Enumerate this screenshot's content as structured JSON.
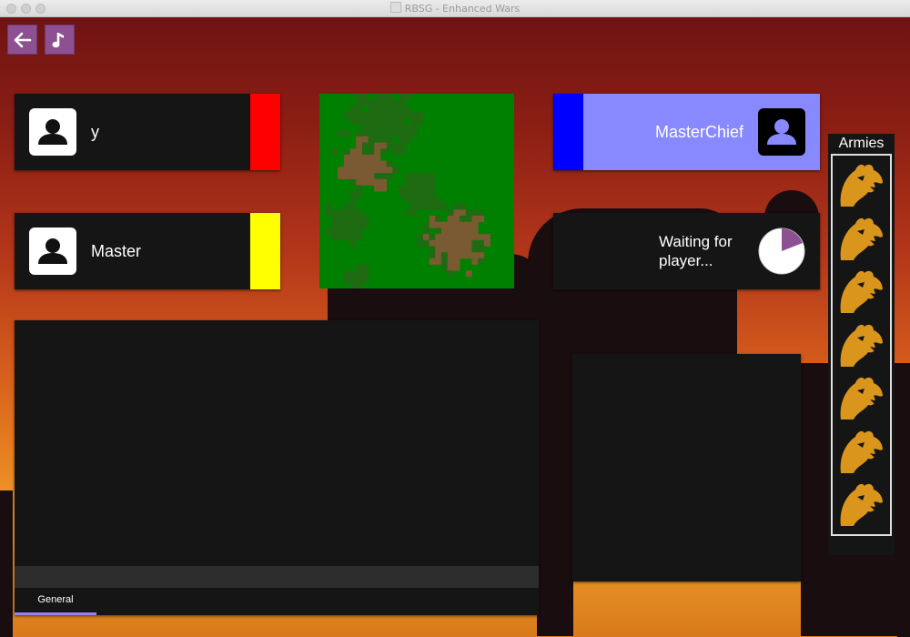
{
  "window": {
    "title": "RBSG - Enhanced Wars"
  },
  "toolbar": {
    "back_icon": "arrow-left-icon",
    "music_icon": "music-note-icon"
  },
  "players": [
    {
      "name": "y",
      "color": "#ff0000",
      "avatar_icon": "user-icon"
    },
    {
      "name": "Master",
      "color": "#ffff00",
      "avatar_icon": "user-icon"
    },
    {
      "name": "MasterChief",
      "color": "#0000ff",
      "avatar_icon": "user-icon",
      "card_bg": "#8888ff"
    }
  ],
  "waiting_slot": {
    "text": "Waiting for\nplayer...",
    "icon": "pie-timer-icon"
  },
  "minimap": {
    "grass_color": "#008000",
    "dirt_color": "#7a5a33"
  },
  "chat": {
    "tab_label": "General",
    "active_tab_color": "#9a82ee"
  },
  "armies": {
    "title": "Armies",
    "count": 7,
    "icon": "dragon-icon",
    "icon_color": "#d9951c"
  }
}
